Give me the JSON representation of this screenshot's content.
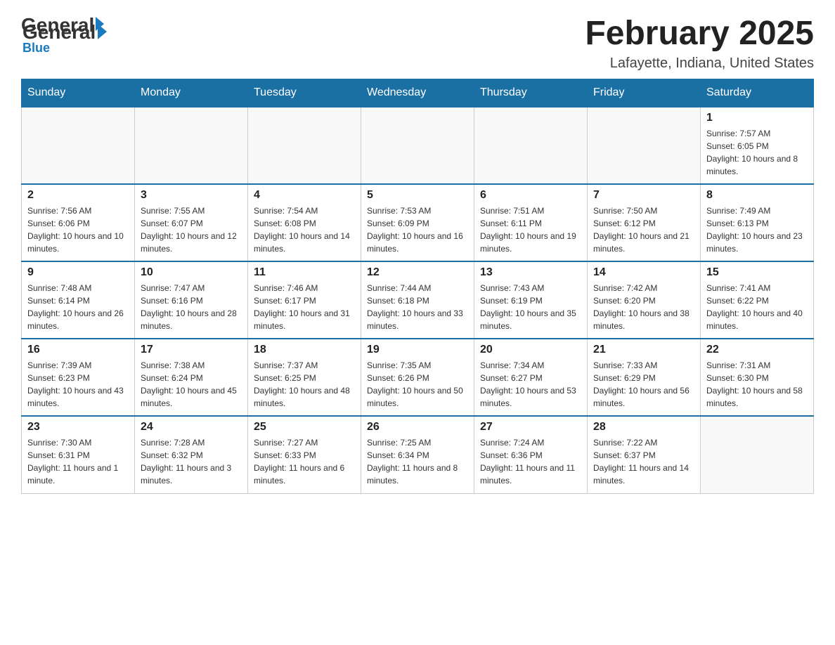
{
  "logo": {
    "general": "General",
    "blue": "Blue"
  },
  "title": "February 2025",
  "location": "Lafayette, Indiana, United States",
  "days_of_week": [
    "Sunday",
    "Monday",
    "Tuesday",
    "Wednesday",
    "Thursday",
    "Friday",
    "Saturday"
  ],
  "weeks": [
    [
      {
        "day": "",
        "info": ""
      },
      {
        "day": "",
        "info": ""
      },
      {
        "day": "",
        "info": ""
      },
      {
        "day": "",
        "info": ""
      },
      {
        "day": "",
        "info": ""
      },
      {
        "day": "",
        "info": ""
      },
      {
        "day": "1",
        "info": "Sunrise: 7:57 AM\nSunset: 6:05 PM\nDaylight: 10 hours and 8 minutes."
      }
    ],
    [
      {
        "day": "2",
        "info": "Sunrise: 7:56 AM\nSunset: 6:06 PM\nDaylight: 10 hours and 10 minutes."
      },
      {
        "day": "3",
        "info": "Sunrise: 7:55 AM\nSunset: 6:07 PM\nDaylight: 10 hours and 12 minutes."
      },
      {
        "day": "4",
        "info": "Sunrise: 7:54 AM\nSunset: 6:08 PM\nDaylight: 10 hours and 14 minutes."
      },
      {
        "day": "5",
        "info": "Sunrise: 7:53 AM\nSunset: 6:09 PM\nDaylight: 10 hours and 16 minutes."
      },
      {
        "day": "6",
        "info": "Sunrise: 7:51 AM\nSunset: 6:11 PM\nDaylight: 10 hours and 19 minutes."
      },
      {
        "day": "7",
        "info": "Sunrise: 7:50 AM\nSunset: 6:12 PM\nDaylight: 10 hours and 21 minutes."
      },
      {
        "day": "8",
        "info": "Sunrise: 7:49 AM\nSunset: 6:13 PM\nDaylight: 10 hours and 23 minutes."
      }
    ],
    [
      {
        "day": "9",
        "info": "Sunrise: 7:48 AM\nSunset: 6:14 PM\nDaylight: 10 hours and 26 minutes."
      },
      {
        "day": "10",
        "info": "Sunrise: 7:47 AM\nSunset: 6:16 PM\nDaylight: 10 hours and 28 minutes."
      },
      {
        "day": "11",
        "info": "Sunrise: 7:46 AM\nSunset: 6:17 PM\nDaylight: 10 hours and 31 minutes."
      },
      {
        "day": "12",
        "info": "Sunrise: 7:44 AM\nSunset: 6:18 PM\nDaylight: 10 hours and 33 minutes."
      },
      {
        "day": "13",
        "info": "Sunrise: 7:43 AM\nSunset: 6:19 PM\nDaylight: 10 hours and 35 minutes."
      },
      {
        "day": "14",
        "info": "Sunrise: 7:42 AM\nSunset: 6:20 PM\nDaylight: 10 hours and 38 minutes."
      },
      {
        "day": "15",
        "info": "Sunrise: 7:41 AM\nSunset: 6:22 PM\nDaylight: 10 hours and 40 minutes."
      }
    ],
    [
      {
        "day": "16",
        "info": "Sunrise: 7:39 AM\nSunset: 6:23 PM\nDaylight: 10 hours and 43 minutes."
      },
      {
        "day": "17",
        "info": "Sunrise: 7:38 AM\nSunset: 6:24 PM\nDaylight: 10 hours and 45 minutes."
      },
      {
        "day": "18",
        "info": "Sunrise: 7:37 AM\nSunset: 6:25 PM\nDaylight: 10 hours and 48 minutes."
      },
      {
        "day": "19",
        "info": "Sunrise: 7:35 AM\nSunset: 6:26 PM\nDaylight: 10 hours and 50 minutes."
      },
      {
        "day": "20",
        "info": "Sunrise: 7:34 AM\nSunset: 6:27 PM\nDaylight: 10 hours and 53 minutes."
      },
      {
        "day": "21",
        "info": "Sunrise: 7:33 AM\nSunset: 6:29 PM\nDaylight: 10 hours and 56 minutes."
      },
      {
        "day": "22",
        "info": "Sunrise: 7:31 AM\nSunset: 6:30 PM\nDaylight: 10 hours and 58 minutes."
      }
    ],
    [
      {
        "day": "23",
        "info": "Sunrise: 7:30 AM\nSunset: 6:31 PM\nDaylight: 11 hours and 1 minute."
      },
      {
        "day": "24",
        "info": "Sunrise: 7:28 AM\nSunset: 6:32 PM\nDaylight: 11 hours and 3 minutes."
      },
      {
        "day": "25",
        "info": "Sunrise: 7:27 AM\nSunset: 6:33 PM\nDaylight: 11 hours and 6 minutes."
      },
      {
        "day": "26",
        "info": "Sunrise: 7:25 AM\nSunset: 6:34 PM\nDaylight: 11 hours and 8 minutes."
      },
      {
        "day": "27",
        "info": "Sunrise: 7:24 AM\nSunset: 6:36 PM\nDaylight: 11 hours and 11 minutes."
      },
      {
        "day": "28",
        "info": "Sunrise: 7:22 AM\nSunset: 6:37 PM\nDaylight: 11 hours and 14 minutes."
      },
      {
        "day": "",
        "info": ""
      }
    ]
  ]
}
